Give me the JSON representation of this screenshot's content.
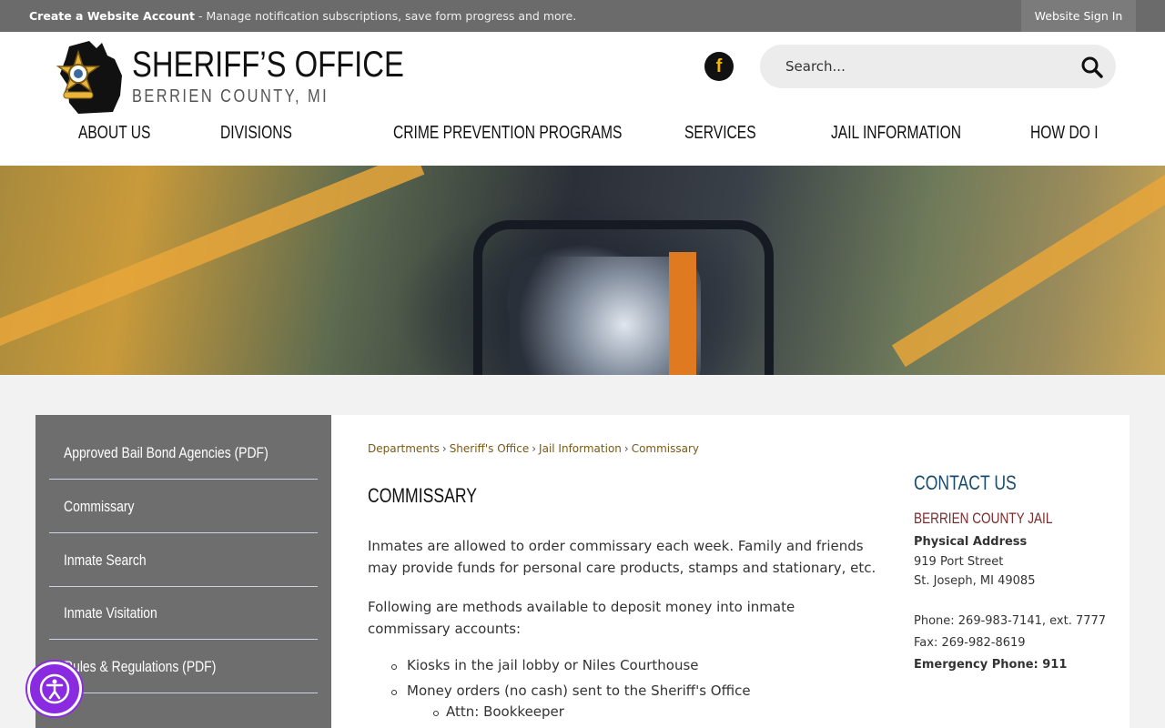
{
  "topbar": {
    "create_account_label": "Create a Website Account",
    "create_account_desc": " - Manage notification subscriptions, save form progress and more.",
    "sign_in_label": "Website Sign In"
  },
  "header": {
    "logo_title": "SHERIFF’S OFFICE",
    "logo_subtitle": "BERRIEN COUNTY, MI",
    "facebook_glyph": "f",
    "search_placeholder": "Search..."
  },
  "nav": {
    "items": [
      {
        "label": "ABOUT US"
      },
      {
        "label": "DIVISIONS"
      },
      {
        "label": "CRIME PREVENTION PROGRAMS"
      },
      {
        "label": "SERVICES"
      },
      {
        "label": "JAIL INFORMATION"
      },
      {
        "label": "HOW DO I"
      }
    ]
  },
  "sidebar": {
    "items": [
      {
        "label": "Approved Bail Bond Agencies (PDF)"
      },
      {
        "label": "Commissary"
      },
      {
        "label": "Inmate Search"
      },
      {
        "label": "Inmate Visitation"
      },
      {
        "label": "Rules & Regulations (PDF)"
      }
    ]
  },
  "breadcrumb": {
    "items": [
      "Departments",
      "Sheriff's Office",
      "Jail Information",
      "Commissary"
    ],
    "separator": "›"
  },
  "main": {
    "title": "COMMISSARY",
    "paragraph1": "Inmates are allowed to order commissary each week. Family and friends may provide funds for personal care products, stamps and stationary, etc.",
    "paragraph2": "Following are methods available to deposit money into inmate commissary accounts:",
    "list": [
      "Kiosks in the jail lobby or Niles Courthouse",
      "Money orders (no cash) sent to the Sheriff's Office",
      "Attn: Bookkeeper"
    ]
  },
  "contact": {
    "title": "CONTACT US",
    "name": "BERRIEN COUNTY JAIL",
    "address_label": "Physical Address",
    "street": "919 Port Street",
    "city": "St. Joseph, MI 49085",
    "phone": "Phone: 269-983-7141, ext. 7777",
    "fax": "Fax: 269-982-8619",
    "emergency": "Emergency Phone: 911"
  },
  "colors": {
    "topbar": "#6b6b6b",
    "sidebar": "#6e6e6e",
    "link": "#7a5a14",
    "contact_title": "#1b4b6b",
    "jail_name": "#7a2a2a",
    "accessibility": "#8a2be2"
  },
  "icons": {
    "facebook": "facebook-icon",
    "search": "search-icon",
    "badge": "sheriff-badge-icon",
    "accessibility": "accessibility-icon"
  }
}
